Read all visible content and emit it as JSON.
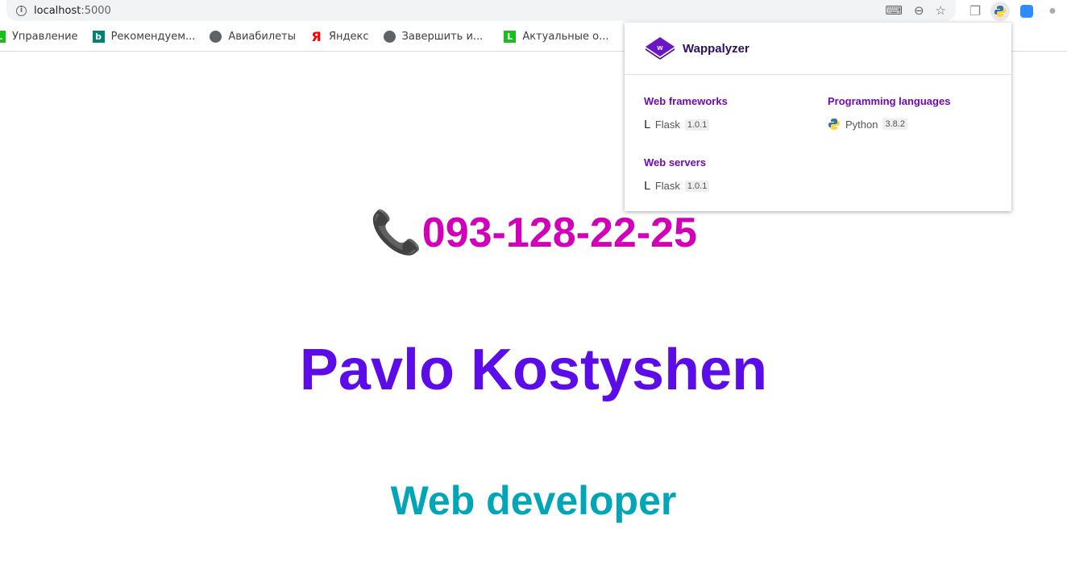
{
  "browser": {
    "url_host": "localhost",
    "url_port": ":5000"
  },
  "bookmarks": [
    {
      "label": "Управление",
      "icon": "lp-icon",
      "color": "#1bbf1b"
    },
    {
      "label": "Рекомендуем...",
      "icon": "bing-icon",
      "color": "#008373"
    },
    {
      "label": "Авиабилеты",
      "icon": "globe-icon",
      "color": "#5f6368"
    },
    {
      "label": "Яндекс",
      "icon": "yandex-icon",
      "color": "#ff0000"
    },
    {
      "label": "Завершить и...",
      "icon": "globe-icon",
      "color": "#5f6368"
    },
    {
      "label": "Актуальные о...",
      "icon": "lp-icon",
      "color": "#1bbf1b"
    }
  ],
  "page": {
    "phone": "093-128-22-25",
    "name": "Pavlo Kostyshen",
    "role": "Web developer"
  },
  "wappalyzer": {
    "brand": "Wappalyzer",
    "categories": [
      {
        "title": "Web frameworks",
        "items": [
          {
            "name": "Flask",
            "version": "1.0.1"
          }
        ]
      },
      {
        "title": "Programming languages",
        "items": [
          {
            "name": "Python",
            "version": "3.8.2"
          }
        ]
      },
      {
        "title": "Web servers",
        "items": [
          {
            "name": "Flask",
            "version": "1.0.1"
          }
        ]
      }
    ]
  }
}
